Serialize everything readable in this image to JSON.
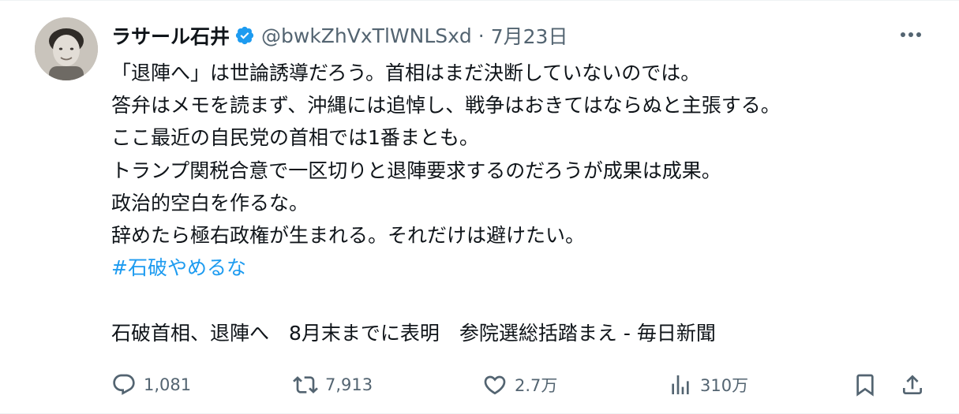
{
  "author": {
    "name": "ラサール石井",
    "handle": "@bwkZhVxTlWNLSxd",
    "date": "7月23日",
    "separator": "·"
  },
  "tweet": {
    "lines": [
      "「退陣へ」は世論誘導だろう。首相はまだ決断していないのでは。",
      "答弁はメモを読まず、沖縄には追悼し、戦争はおきてはならぬと主張する。",
      "ここ最近の自民党の首相では1番まとも。",
      "トランプ関税合意で一区切りと退陣要求するのだろうが成果は成果。",
      "政治的空白を作るな。",
      "辞めたら極右政権が生まれる。それだけは避けたい。"
    ],
    "hashtag": "#石破やめるな",
    "link_title": "石破首相、退陣へ　8月末までに表明　参院選総括踏まえ - 毎日新聞"
  },
  "actions": {
    "replies": "1,081",
    "retweets": "7,913",
    "likes": "2.7万",
    "views": "310万"
  },
  "colors": {
    "verified": "#1d9bf0",
    "hashtag": "#1d9bf0",
    "muted": "#536471",
    "text": "#0f1419"
  },
  "icons": [
    "verified-badge-icon",
    "more-icon",
    "reply-icon",
    "retweet-icon",
    "like-icon",
    "views-icon",
    "bookmark-icon",
    "share-icon"
  ]
}
